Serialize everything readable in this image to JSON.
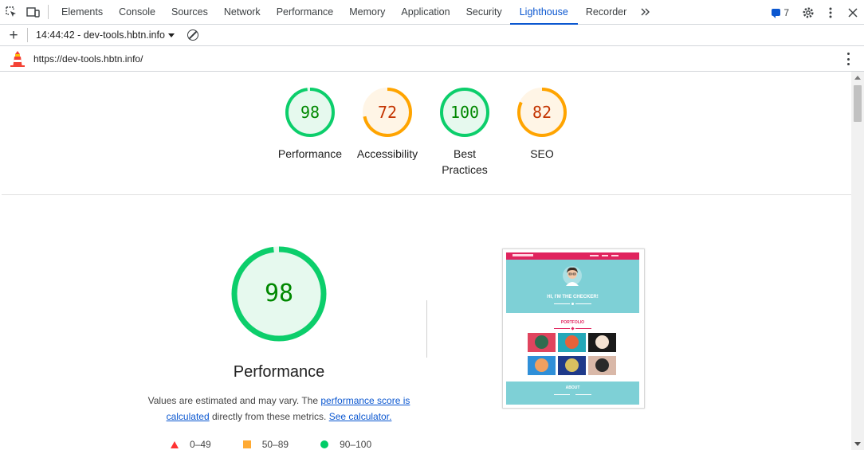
{
  "devtools": {
    "tabs": [
      {
        "label": "Elements"
      },
      {
        "label": "Console"
      },
      {
        "label": "Sources"
      },
      {
        "label": "Network"
      },
      {
        "label": "Performance"
      },
      {
        "label": "Memory"
      },
      {
        "label": "Application"
      },
      {
        "label": "Security"
      },
      {
        "label": "Lighthouse"
      },
      {
        "label": "Recorder"
      }
    ],
    "active_tab": "Lighthouse",
    "more_tabs_icon": "double-chevron-right-icon",
    "issues_count": "7",
    "accent_color": "#0b57d0"
  },
  "toolbar": {
    "report_label": "14:44:42 - dev-tools.hbtn.info"
  },
  "urlbar": {
    "url": "https://dev-tools.hbtn.info/"
  },
  "scores": [
    {
      "label": "Performance",
      "value": "98",
      "fraction": 0.98,
      "status": "pass",
      "ring_color": "#0cce6b",
      "text_color": "#008800",
      "fill": "#e6f9ee"
    },
    {
      "label": "Accessibility",
      "value": "72",
      "fraction": 0.72,
      "status": "average",
      "ring_color": "#ffa400",
      "text_color": "#c33300",
      "fill": "#fff5e6"
    },
    {
      "label": "Best Practices",
      "value": "100",
      "fraction": 1.0,
      "status": "pass",
      "ring_color": "#0cce6b",
      "text_color": "#008800",
      "fill": "#e6f9ee"
    },
    {
      "label": "SEO",
      "value": "82",
      "fraction": 0.82,
      "status": "average",
      "ring_color": "#ffa400",
      "text_color": "#c33300",
      "fill": "#fff5e6"
    }
  ],
  "performance_section": {
    "score": "98",
    "fraction": 0.98,
    "title": "Performance",
    "desc_prefix": "Values are estimated and may vary. The ",
    "link1": "performance score is calculated",
    "desc_middle": " directly from these metrics. ",
    "link2": "See calculator."
  },
  "legend": [
    {
      "range": "0–49",
      "shape": "triangle",
      "color": "#ff3333"
    },
    {
      "range": "50–89",
      "shape": "square",
      "color": "#ffaa33"
    },
    {
      "range": "90–100",
      "shape": "circle",
      "color": "#00cc66"
    }
  ],
  "screenshot": {
    "hero_text": "HI, I'M THE CHECKER!",
    "portfolio_text": "PORTFOLIO",
    "about_text": "ABOUT",
    "header_color": "#e0245e",
    "hero_color": "#7ed0d6"
  }
}
